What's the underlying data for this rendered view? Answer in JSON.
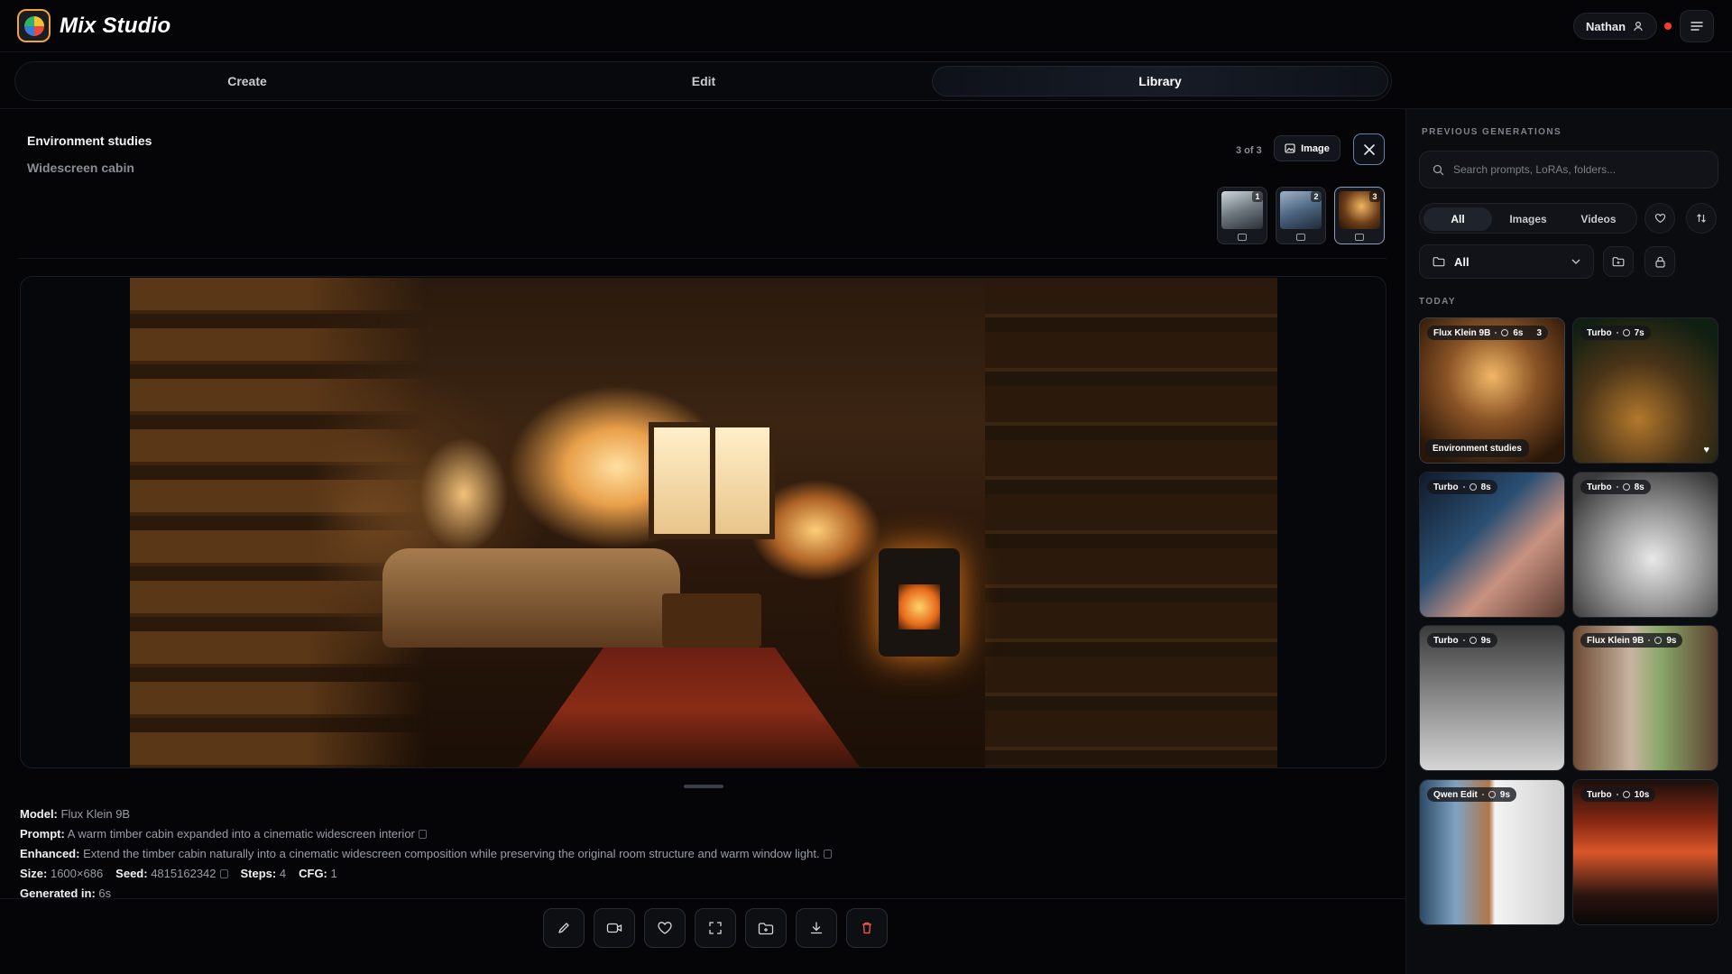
{
  "app": {
    "brand": "Mix Studio"
  },
  "user": {
    "name": "Nathan"
  },
  "tabs": [
    {
      "label": "Create"
    },
    {
      "label": "Edit"
    },
    {
      "label": "Library"
    }
  ],
  "viewer": {
    "title": "Environment studies",
    "subtitle": "Widescreen cabin",
    "counter": "3 of 3",
    "type_label": "Image",
    "thumbs": [
      {
        "n": "1"
      },
      {
        "n": "2"
      },
      {
        "n": "3"
      }
    ]
  },
  "meta": {
    "model_label": "Model:",
    "model": "Flux Klein 9B",
    "prompt_label": "Prompt:",
    "prompt": "A warm timber cabin expanded into a cinematic widescreen interior",
    "enhanced_label": "Enhanced:",
    "enhanced": "Extend the timber cabin naturally into a cinematic widescreen composition while preserving the original room structure and warm window light.",
    "size_label": "Size:",
    "size": "1600×686",
    "seed_label": "Seed:",
    "seed": "4815162342",
    "steps_label": "Steps:",
    "steps": "4",
    "cfg_label": "CFG:",
    "cfg": "1",
    "generated_label": "Generated in:",
    "generated": "6s"
  },
  "sidebar": {
    "title": "PREVIOUS GENERATIONS",
    "search_placeholder": "Search prompts, LoRAs, folders...",
    "filters": [
      "All",
      "Images",
      "Videos"
    ],
    "folder": "All",
    "today": "TODAY",
    "cards": [
      {
        "model": "Flux Klein 9B",
        "time": "6s",
        "count": "3",
        "caption": "Environment studies"
      },
      {
        "model": "Turbo",
        "time": "7s"
      },
      {
        "model": "Turbo",
        "time": "8s"
      },
      {
        "model": "Turbo",
        "time": "8s"
      },
      {
        "model": "Turbo",
        "time": "9s"
      },
      {
        "model": "Flux Klein 9B",
        "time": "9s"
      },
      {
        "model": "Qwen Edit",
        "time": "9s"
      },
      {
        "model": "Turbo",
        "time": "10s"
      }
    ]
  },
  "colors": {
    "accent": "#f0a43a",
    "record": "#ff3b30",
    "background": "#050507"
  }
}
